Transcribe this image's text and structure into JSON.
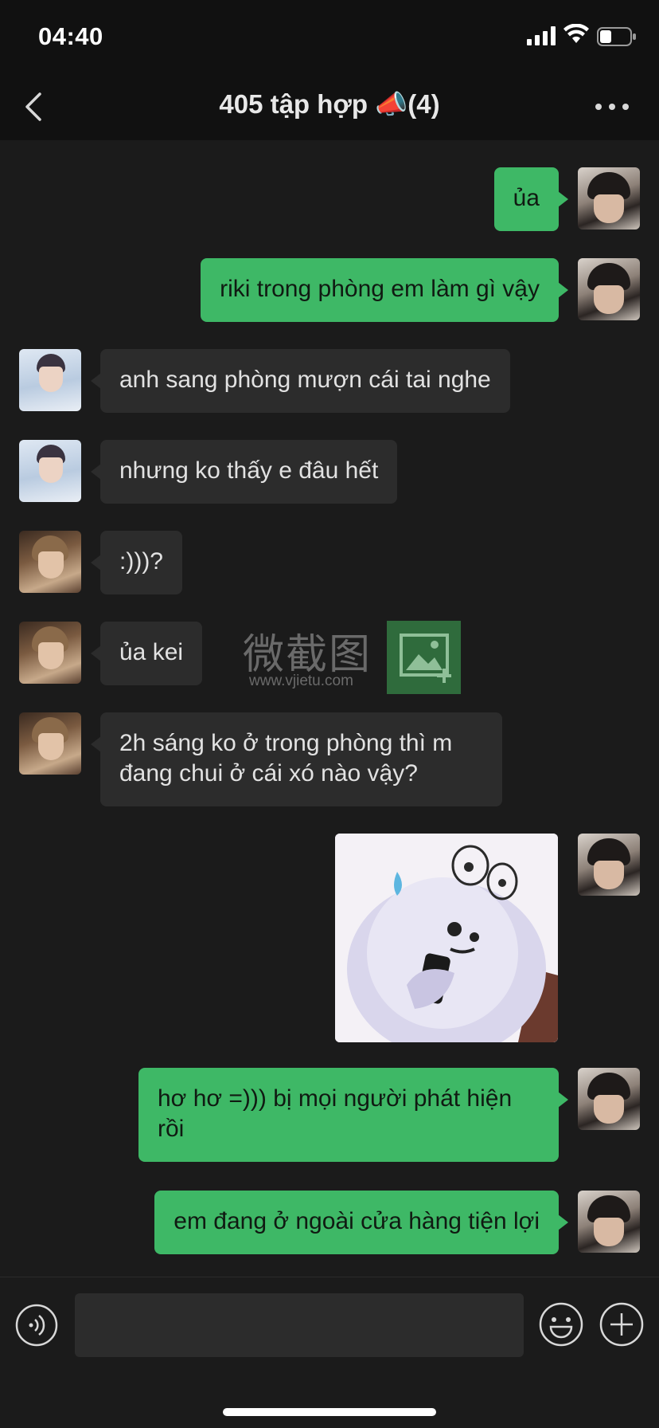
{
  "status_bar": {
    "time": "04:40"
  },
  "header": {
    "title": "405 tập hợp 📣(4)"
  },
  "messages": [
    {
      "side": "out",
      "sender": "self",
      "text": "ủa"
    },
    {
      "side": "out",
      "sender": "self",
      "text": "riki trong phòng em làm gì vậy"
    },
    {
      "side": "in",
      "sender": "member_a",
      "text": "anh sang phòng mượn cái tai nghe"
    },
    {
      "side": "in",
      "sender": "member_a",
      "text": "nhưng ko thấy e đâu hết"
    },
    {
      "side": "in",
      "sender": "member_b",
      "text": ":)))?"
    },
    {
      "side": "in",
      "sender": "member_b",
      "text": "ủa kei"
    },
    {
      "side": "in",
      "sender": "member_b",
      "text": "2h sáng ko ở trong phòng thì m đang chui ở cái xó nào vậy?"
    },
    {
      "side": "out",
      "sender": "self",
      "type": "sticker",
      "sticker": "sweating-blob-with-phone"
    },
    {
      "side": "out",
      "sender": "self",
      "text": "hơ hơ =))) bị mọi người phát hiện rồi"
    },
    {
      "side": "out",
      "sender": "self",
      "text": "em đang ở ngoài cửa hàng tiện lợi"
    }
  ],
  "watermark": {
    "text": "微截图",
    "url": "www.vjietu.com"
  },
  "input_bar": {
    "voice_icon": "voice-icon",
    "message_value": "",
    "emoji_icon": "smiley-icon",
    "plus_icon": "plus-icon"
  },
  "colors": {
    "background": "#1b1b1b",
    "bar": "#111111",
    "outgoing_bubble": "#3eb866",
    "incoming_bubble": "#2c2c2c"
  }
}
